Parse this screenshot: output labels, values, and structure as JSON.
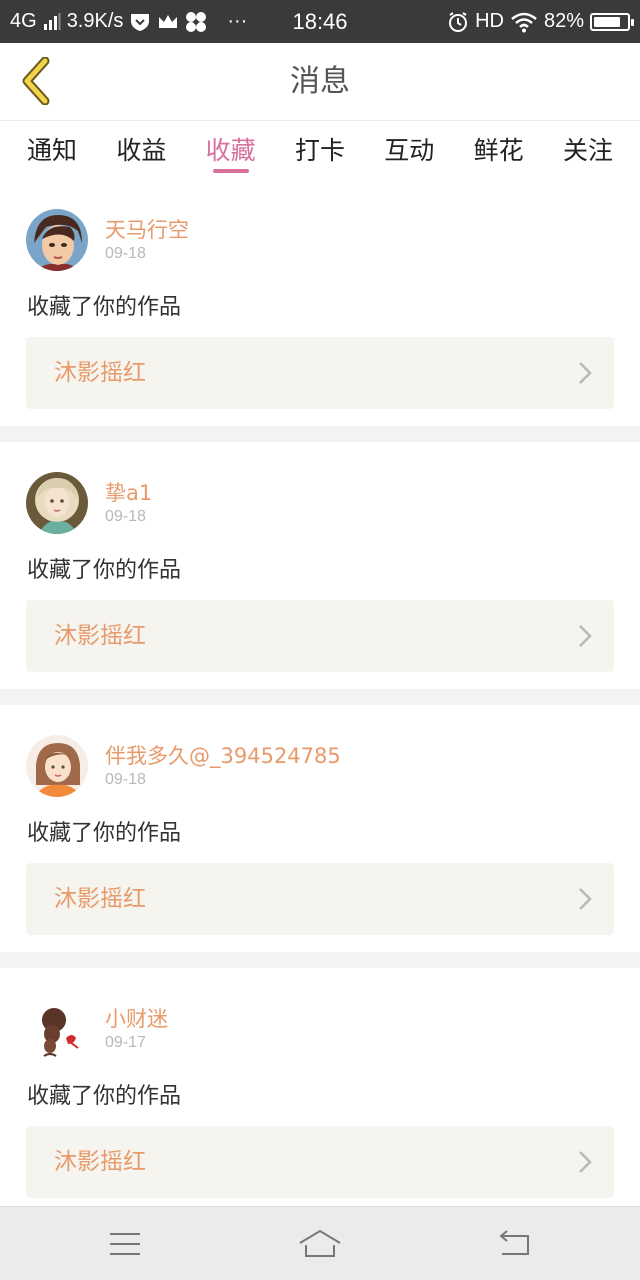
{
  "status_bar": {
    "network": "4G",
    "speed": "3.9K/s",
    "more": "···",
    "time": "18:46",
    "hd": "HD",
    "battery": "82%",
    "battery_level": 0.82
  },
  "header": {
    "title": "消息"
  },
  "tabs": [
    {
      "label": "通知",
      "active": false
    },
    {
      "label": "收益",
      "active": false
    },
    {
      "label": "收藏",
      "active": true
    },
    {
      "label": "打卡",
      "active": false
    },
    {
      "label": "互动",
      "active": false
    },
    {
      "label": "鲜花",
      "active": false
    },
    {
      "label": "关注",
      "active": false
    }
  ],
  "messages": [
    {
      "user": "天马行空",
      "date": "09-18",
      "action": "收藏了你的作品",
      "work": "沐影摇红"
    },
    {
      "user": "挚a1",
      "date": "09-18",
      "action": "收藏了你的作品",
      "work": "沐影摇红"
    },
    {
      "user": "伴我多久@_394524785",
      "date": "09-18",
      "action": "收藏了你的作品",
      "work": "沐影摇红"
    },
    {
      "user": "小财迷",
      "date": "09-17",
      "action": "收藏了你的作品",
      "work": "沐影摇红"
    }
  ],
  "colors": {
    "accent": "#d8719c",
    "name": "#e89a6a",
    "statusbar": "#3a3a3a"
  },
  "icons": [
    "back-chevron-icon",
    "chevron-right-icon",
    "menu-icon",
    "home-icon",
    "return-icon"
  ]
}
